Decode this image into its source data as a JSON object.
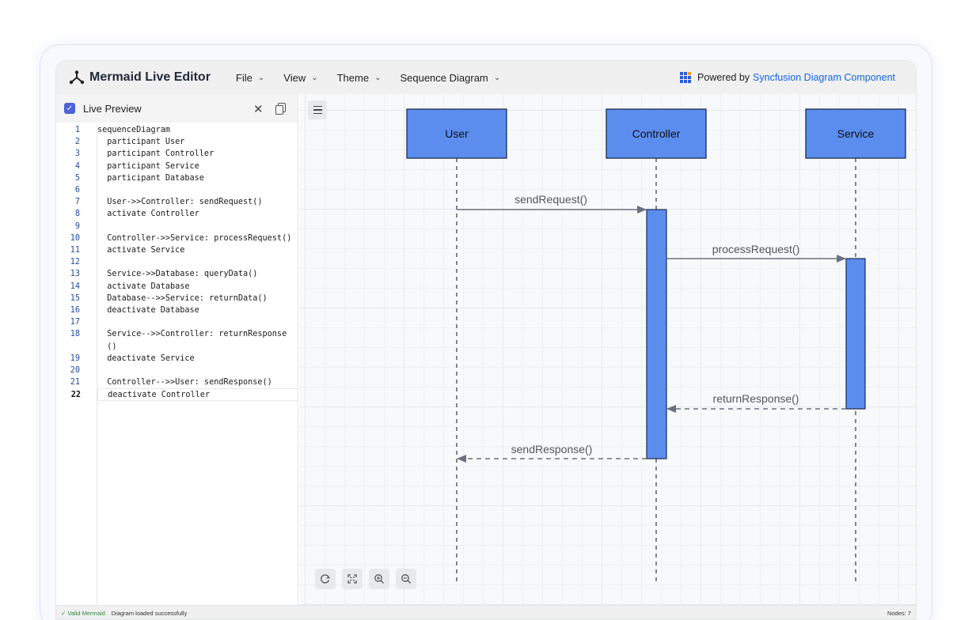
{
  "header": {
    "app_title": "Mermaid Live Editor",
    "menu": [
      {
        "label": "File"
      },
      {
        "label": "View"
      },
      {
        "label": "Theme"
      },
      {
        "label": "Sequence Diagram"
      }
    ],
    "powered_by": "Powered by",
    "powered_link": "Syncfusion Diagram Component"
  },
  "left_panel": {
    "title": "Live Preview",
    "live_preview_checked": true,
    "code_lines": [
      {
        "n": "1",
        "text": "sequenceDiagram"
      },
      {
        "n": "2",
        "text": "  participant User"
      },
      {
        "n": "3",
        "text": "  participant Controller"
      },
      {
        "n": "4",
        "text": "  participant Service"
      },
      {
        "n": "5",
        "text": "  participant Database"
      },
      {
        "n": "6",
        "text": ""
      },
      {
        "n": "7",
        "text": "  User->>Controller: sendRequest()"
      },
      {
        "n": "8",
        "text": "  activate Controller"
      },
      {
        "n": "9",
        "text": ""
      },
      {
        "n": "10",
        "text": "  Controller->>Service: processRequest()"
      },
      {
        "n": "11",
        "text": "  activate Service"
      },
      {
        "n": "12",
        "text": ""
      },
      {
        "n": "13",
        "text": "  Service->>Database: queryData()"
      },
      {
        "n": "14",
        "text": "  activate Database"
      },
      {
        "n": "15",
        "text": "  Database-->>Service: returnData()"
      },
      {
        "n": "16",
        "text": "  deactivate Database"
      },
      {
        "n": "17",
        "text": ""
      },
      {
        "n": "18",
        "text": "  Service-->>Controller: returnResponse"
      },
      {
        "n": "",
        "text": "  ()"
      },
      {
        "n": "19",
        "text": "  deactivate Service"
      },
      {
        "n": "20",
        "text": ""
      },
      {
        "n": "21",
        "text": "  Controller-->>User: sendResponse()"
      },
      {
        "n": "22",
        "text": "  deactivate Controller"
      }
    ]
  },
  "diagram": {
    "participants": [
      {
        "name": "User"
      },
      {
        "name": "Controller"
      },
      {
        "name": "Service"
      }
    ],
    "messages": [
      {
        "label": "sendRequest()",
        "style": "solid"
      },
      {
        "label": "processRequest()",
        "style": "solid"
      },
      {
        "label": "returnResponse()",
        "style": "dashed"
      },
      {
        "label": "sendResponse()",
        "style": "dashed"
      }
    ],
    "colors": {
      "box_fill": "#5b8def",
      "box_stroke": "#1f2d4d",
      "arrow": "#6b7080"
    }
  },
  "status": {
    "valid": "✓ Valid Mermaid",
    "message": "Diagram loaded successfully",
    "nodes": "Nodes: 7"
  }
}
